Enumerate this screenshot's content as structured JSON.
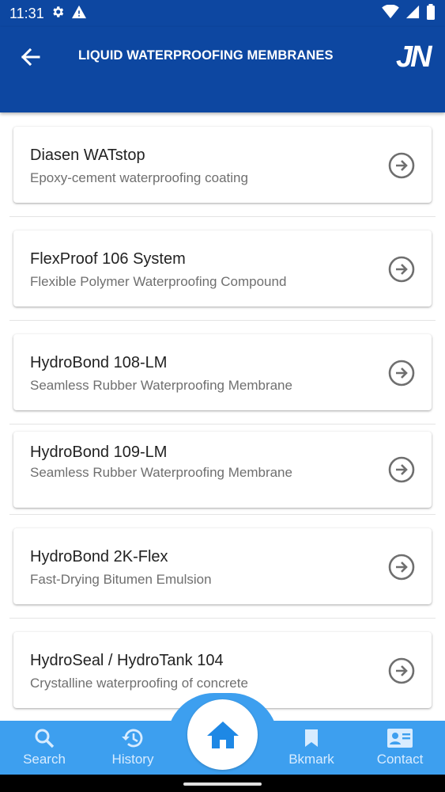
{
  "status_bar": {
    "time": "11:31",
    "left_icons": [
      "gear-icon",
      "warning-icon"
    ],
    "right_icons": [
      "wifi-icon",
      "signal-icon",
      "battery-icon"
    ]
  },
  "app_bar": {
    "title": "LIQUID WATERPROOFING MEMBRANES",
    "back_icon": "arrow-back-icon",
    "logo_text": "JN"
  },
  "products": [
    {
      "title": "Diasen WATstop",
      "subtitle": "Epoxy-cement waterproofing coating"
    },
    {
      "title": "FlexProof 106 System",
      "subtitle": "Flexible Polymer Waterproofing Compound"
    },
    {
      "title": "HydroBond 108-LM",
      "subtitle": "Seamless Rubber Waterproofing Membrane"
    },
    {
      "title": "HydroBond 109-LM",
      "subtitle": "Seamless Rubber Waterproofing Membrane"
    },
    {
      "title": "HydroBond 2K-Flex",
      "subtitle": "Fast-Drying Bitumen Emulsion"
    },
    {
      "title": "HydroSeal / HydroTank 104",
      "subtitle": "Crystalline waterproofing of concrete"
    }
  ],
  "bottom_nav": {
    "search": "Search",
    "history": "History",
    "home_icon": "home-icon",
    "bookmark": "Bkmark",
    "contact": "Contact"
  },
  "colors": {
    "app_bar": "#0d47a1",
    "bottom_nav": "#3d9fef",
    "nav_label": "#d8ecff"
  }
}
